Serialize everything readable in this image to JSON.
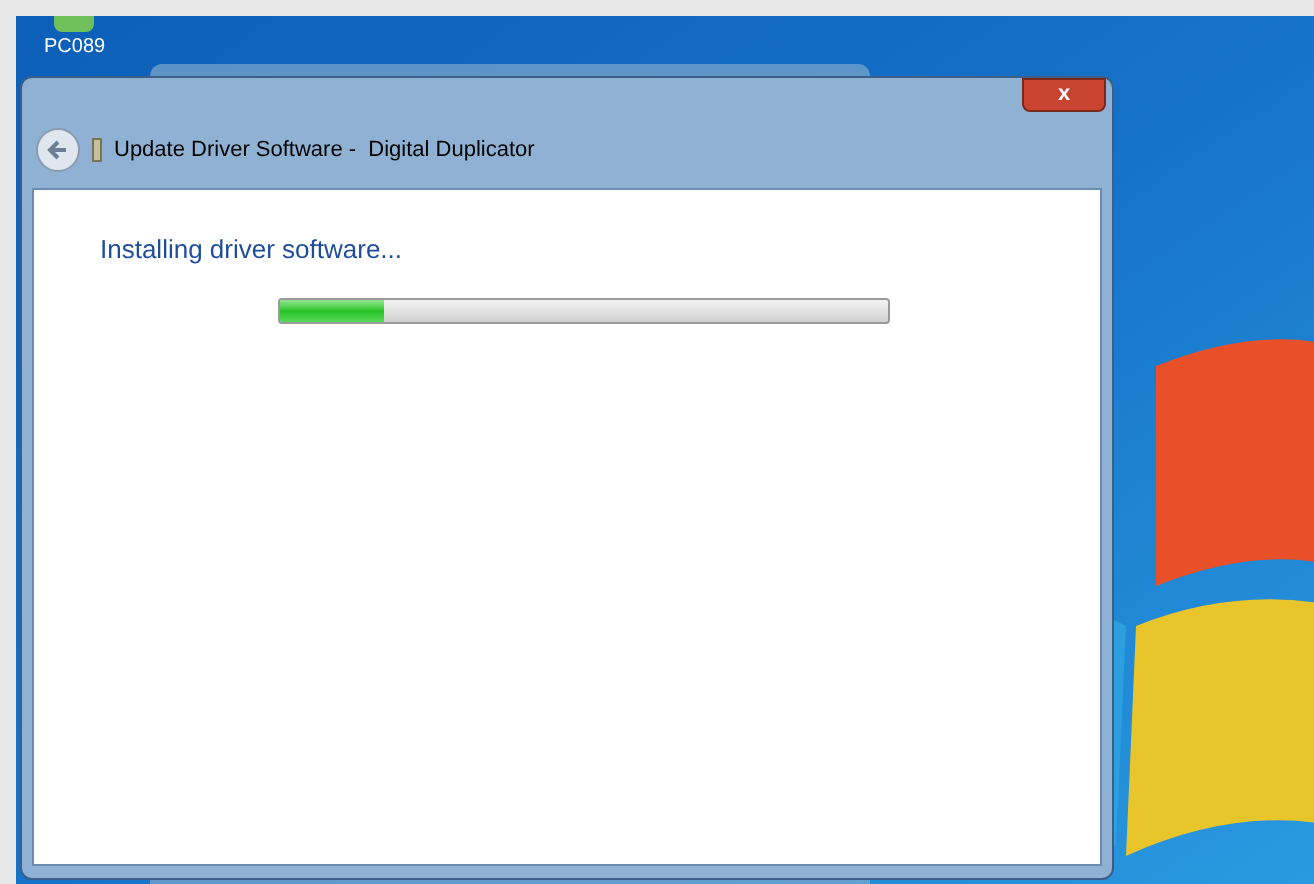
{
  "desktop": {
    "icons": [
      {
        "label": "PC089"
      }
    ]
  },
  "window": {
    "title": "Update Driver Software -  Digital Duplicator",
    "close": "x"
  },
  "content": {
    "heading": "Installing driver software...",
    "progress": {
      "level": 0.17
    }
  }
}
